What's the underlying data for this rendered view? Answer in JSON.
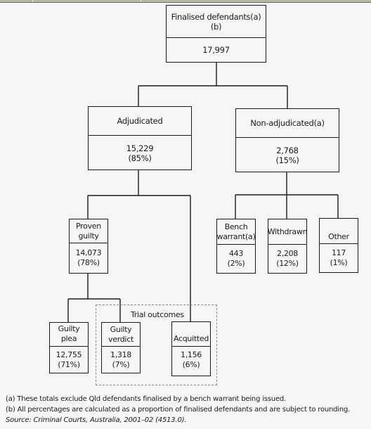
{
  "nodes": {
    "finalised": {
      "label": "Finalised defendants(a)(b)",
      "value": "17,997",
      "percent": ""
    },
    "adjudicated": {
      "label": "Adjudicated",
      "value": "15,229",
      "percent": "(85%)"
    },
    "non_adjudicated": {
      "label": "Non-adjudicated(a)",
      "value": "2,768",
      "percent": "(15%)"
    },
    "proven_guilty": {
      "label_line1": "Proven",
      "label_line2": "guilty",
      "value": "14,073",
      "percent": "(78%)"
    },
    "bench_warrant": {
      "label_line1": "Bench",
      "label_line2": "warrant(a)",
      "value": "443",
      "percent": "(2%)"
    },
    "withdrawn": {
      "label": "Withdrawn",
      "value": "2,208",
      "percent": "(12%)"
    },
    "other": {
      "label": "Other",
      "value": "117",
      "percent": "(1%)"
    },
    "guilty_plea": {
      "label": "Guilty plea",
      "value": "12,755",
      "percent": "(71%)"
    },
    "guilty_verdict": {
      "label_line1": "Guilty",
      "label_line2": "verdict",
      "value": "1,318",
      "percent": "(7%)"
    },
    "acquitted": {
      "label": "Acquitted",
      "value": "1,156",
      "percent": "(6%)"
    }
  },
  "group": {
    "label": "Trial outcomes"
  },
  "footnotes": {
    "a": "(a) These totals exclude Qld defendants finalised by a bench warrant being issued.",
    "b": "(b) All percentages are calculated as a proportion of finalised defendants and are subject to rounding.",
    "source": "Source: Criminal Courts, Australia, 2001–02 (4513.0)."
  },
  "colors": {
    "line": "#1a1a1d",
    "dashed": "#8a8a8a",
    "background": "#f6f6f6"
  }
}
